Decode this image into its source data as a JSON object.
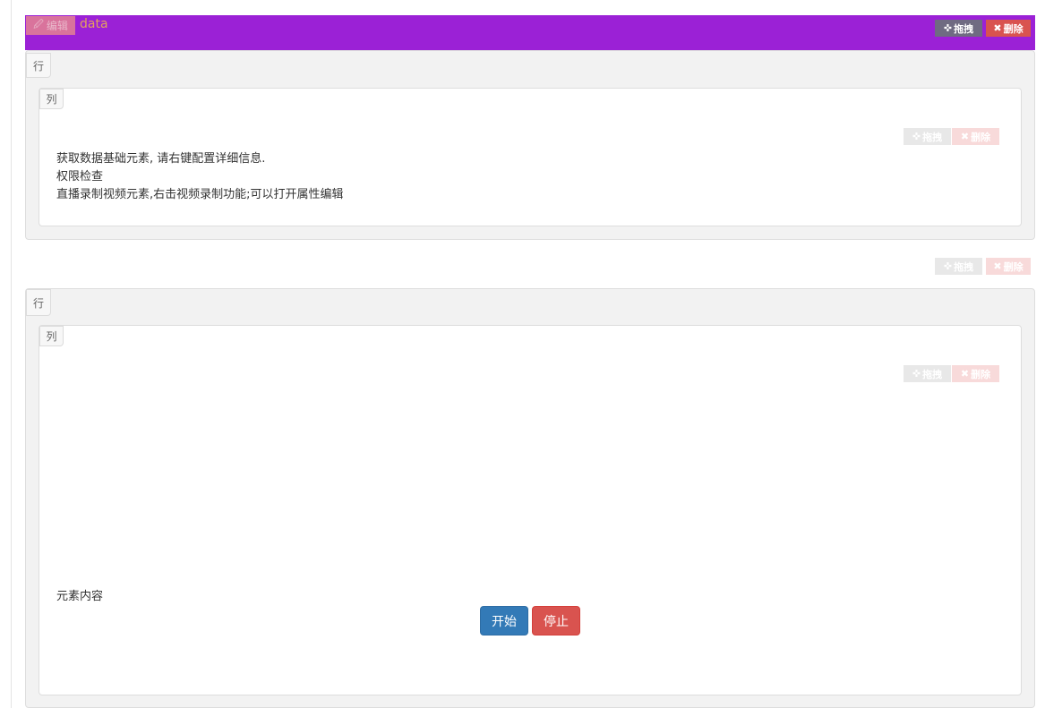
{
  "block1": {
    "edit_label": "编辑",
    "edit_icon": "edit-icon",
    "title": "data",
    "drag_label": "拖拽",
    "drag_icon": "move-icon",
    "delete_label": "删除",
    "delete_icon": "close-icon",
    "row_tag": "行",
    "column": {
      "tag": "列",
      "drag_label": "拖拽",
      "delete_label": "删除",
      "lines": [
        "获取数据基础元素, 请右键配置详细信息.",
        "权限检查",
        "直播录制视频元素,右击视频录制功能;可以打开属性编辑"
      ]
    }
  },
  "block2": {
    "drag_label": "拖拽",
    "delete_label": "删除",
    "row_tag": "行",
    "column": {
      "tag": "列",
      "drag_label": "拖拽",
      "delete_label": "删除",
      "content_text": "元素内容",
      "start_label": "开始",
      "stop_label": "停止"
    }
  },
  "colors": {
    "header_purple": "#9b21d6",
    "edit_pink": "#d9739c",
    "title_orange": "#e3a25d",
    "danger": "#d9534f",
    "primary": "#337ab7"
  }
}
